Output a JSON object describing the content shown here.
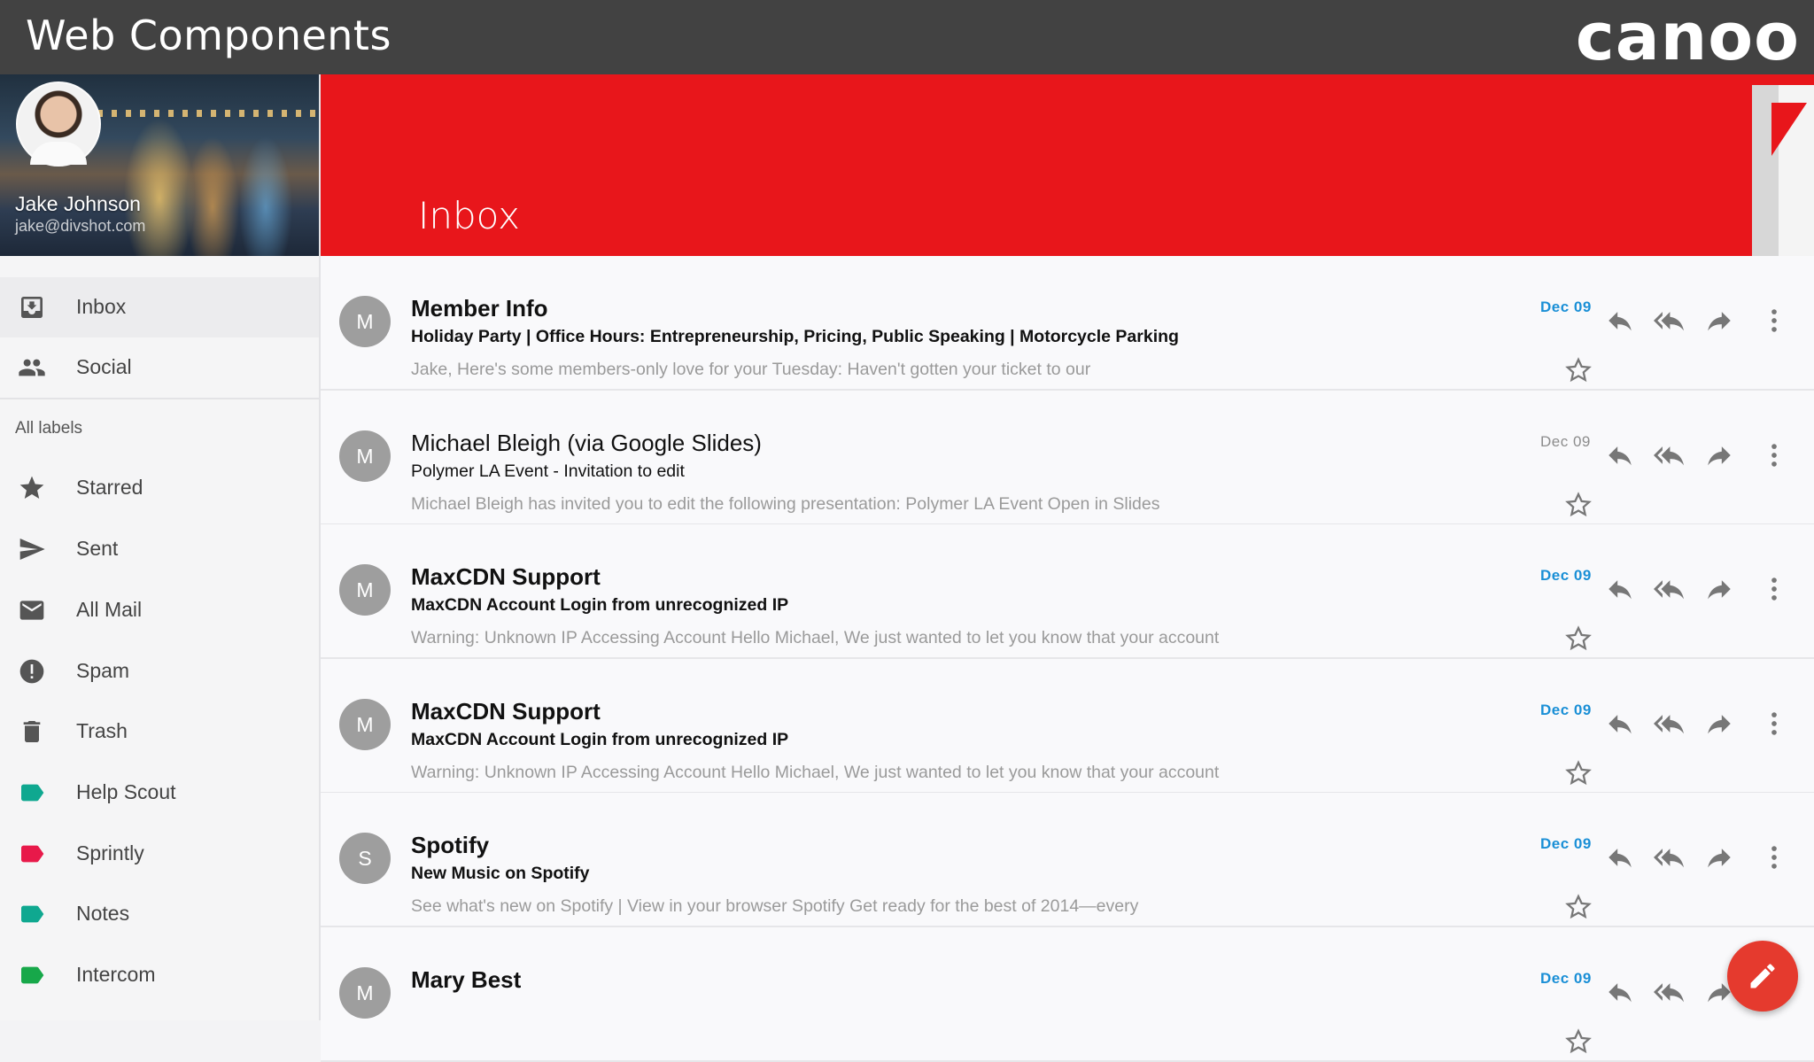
{
  "topbar": {
    "title": "Web Components",
    "logo": "canoo"
  },
  "profile": {
    "name": "Jake Johnson",
    "email": "jake@divshot.com"
  },
  "sidebar": {
    "primary": [
      {
        "label": "Inbox",
        "icon": "inbox-icon",
        "active": true
      },
      {
        "label": "Social",
        "icon": "people-icon",
        "active": false
      }
    ],
    "section_label": "All labels",
    "labels": [
      {
        "label": "Starred",
        "icon": "star-icon"
      },
      {
        "label": "Sent",
        "icon": "send-icon"
      },
      {
        "label": "All Mail",
        "icon": "mail-icon"
      },
      {
        "label": "Spam",
        "icon": "spam-icon"
      },
      {
        "label": "Trash",
        "icon": "trash-icon"
      },
      {
        "label": "Help Scout",
        "icon": "label-icon",
        "color": "#0fa890"
      },
      {
        "label": "Sprintly",
        "icon": "label-icon",
        "color": "#e8194a"
      },
      {
        "label": "Notes",
        "icon": "label-icon",
        "color": "#0fa890"
      },
      {
        "label": "Intercom",
        "icon": "label-icon",
        "color": "#17a84a"
      }
    ]
  },
  "header": {
    "title": "Inbox",
    "color": "#e8161b"
  },
  "emails": [
    {
      "initial": "M",
      "sender": "Member Info",
      "subject": "Holiday Party | Office Hours: Entrepreneurship, Pricing, Public Speaking | Motorcycle Parking",
      "snippet": "Jake, Here's some members-only love for your Tuesday: Haven't gotten your ticket to our",
      "date": "Dec 09",
      "unread": true
    },
    {
      "initial": "M",
      "sender": "Michael Bleigh (via Google Slides)",
      "subject": "Polymer LA Event - Invitation to edit",
      "snippet": "Michael Bleigh has invited you to edit the following presentation: Polymer LA Event Open in Slides",
      "date": "Dec 09",
      "unread": false
    },
    {
      "initial": "M",
      "sender": "MaxCDN Support",
      "subject": "MaxCDN Account Login from unrecognized IP",
      "snippet": "Warning: Unknown IP Accessing Account Hello Michael, We just wanted to let you know that your account",
      "date": "Dec 09",
      "unread": true
    },
    {
      "initial": "M",
      "sender": "MaxCDN Support",
      "subject": "MaxCDN Account Login from unrecognized IP",
      "snippet": "Warning: Unknown IP Accessing Account Hello Michael, We just wanted to let you know that your account",
      "date": "Dec 09",
      "unread": true
    },
    {
      "initial": "S",
      "sender": "Spotify",
      "subject": "New Music on Spotify",
      "snippet": "See what's new on Spotify | View in your browser Spotify Get ready for the best of 2014—every",
      "date": "Dec 09",
      "unread": true
    },
    {
      "initial": "M",
      "sender": "Mary Best",
      "subject": "",
      "snippet": "",
      "date": "Dec 09",
      "unread": true
    }
  ],
  "colors": {
    "unread_date": "#1a8fd6",
    "fab": "#e53a2e"
  },
  "fab_icon": "pencil-icon"
}
